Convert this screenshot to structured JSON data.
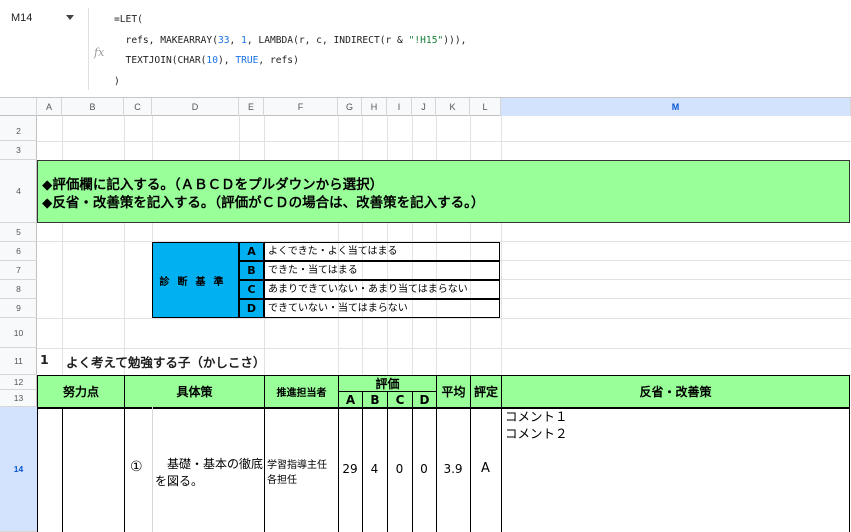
{
  "formula_bar": {
    "name_box": "M14",
    "fx_icon": "fx",
    "formula_lines": [
      "=LET(",
      "  refs, MAKEARRAY(33, 1, LAMBDA(r, c, INDIRECT(r & \"!H15\"))),",
      "  TEXTJOIN(CHAR(10), TRUE, refs)",
      ")"
    ]
  },
  "columns": [
    "A",
    "B",
    "C",
    "D",
    "E",
    "F",
    "G",
    "H",
    "I",
    "J",
    "K",
    "L",
    "M"
  ],
  "selected_column": "M",
  "rows": [
    "2",
    "3",
    "4",
    "5",
    "6",
    "7",
    "8",
    "9",
    "10",
    "11",
    "12",
    "13",
    "14"
  ],
  "selected_row": "14",
  "banner": {
    "line1": "◆評価欄に記入する。（ＡＢＣＤをプルダウンから選択）",
    "line2": "◆反省・改善策を記入する。（評価がＣＤの場合は、改善策を記入する。）"
  },
  "criteria": {
    "label": "診断基準",
    "items": [
      {
        "letter": "A",
        "desc": "よくできた・よく当てはまる"
      },
      {
        "letter": "B",
        "desc": "できた・当てはまる"
      },
      {
        "letter": "C",
        "desc": "あまりできていない・あまり当てはまらない"
      },
      {
        "letter": "D",
        "desc": "できていない・当てはまらない"
      }
    ]
  },
  "section": {
    "number": "1",
    "title": "よく考えて勉強する子（かしこさ）"
  },
  "table_header": {
    "effort": "努力点",
    "measures": "具体策",
    "person": "推進担当者",
    "evaluation": "評価",
    "eval_cols": [
      "A",
      "B",
      "C",
      "D"
    ],
    "average": "平均",
    "rating": "評定",
    "reflection": "反省・改善策"
  },
  "row14": {
    "mark": "①",
    "measure": "　基礎・基本の徹底を図る。",
    "person_line1": "学習指導主任",
    "person_line2": "各担任",
    "a": "29",
    "b": "4",
    "c": "0",
    "d": "0",
    "avg": "3.9",
    "rating": "A",
    "comment_line1": "コメント１",
    "comment_line2": "コメント２"
  },
  "colors": {
    "banner_green": "#99ff99",
    "criteria_blue": "#00b0f0",
    "selection_blue": "#d3e3fd"
  }
}
